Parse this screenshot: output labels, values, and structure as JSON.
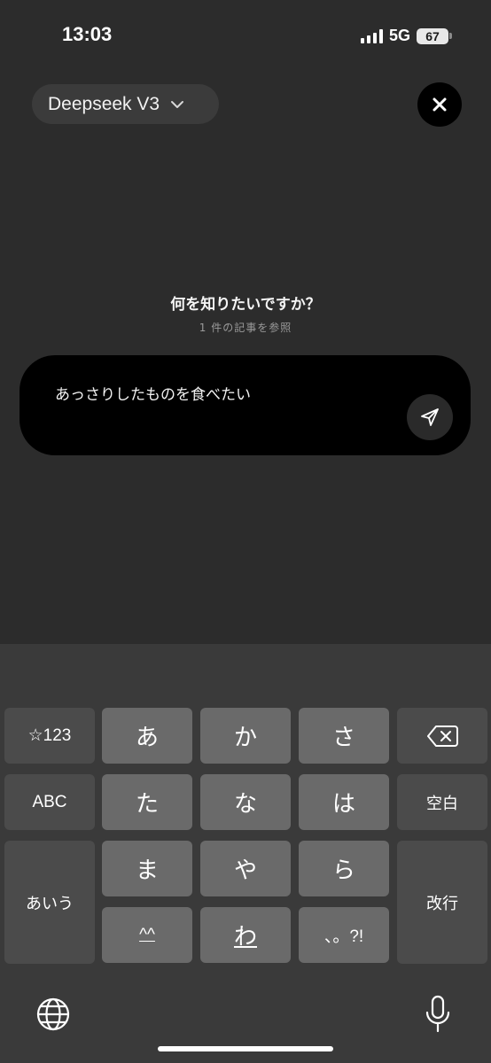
{
  "status_bar": {
    "time": "13:03",
    "network": "5G",
    "battery": "67"
  },
  "header": {
    "model_label": "Deepseek V3"
  },
  "prompt": {
    "title": "何を知りたいですか？",
    "subtitle": "1 件の記事を参照",
    "input_value": "あっさりしたものを食べたい"
  },
  "keyboard": {
    "row1": {
      "mode": "☆123",
      "k1": "あ",
      "k2": "か",
      "k3": "さ"
    },
    "row2": {
      "mode": "ABC",
      "k1": "た",
      "k2": "な",
      "k3": "は",
      "space": "空白"
    },
    "row3": {
      "mode": "あいう",
      "k1": "ま",
      "k2": "や",
      "k3": "ら",
      "enter": "改行"
    },
    "row4": {
      "k1": "^^",
      "k2": "わ",
      "k3": "、。?!"
    }
  },
  "icons": {
    "chevron": "chevron-down-icon",
    "close": "close-icon",
    "send": "send-icon",
    "backspace": "backspace-icon",
    "globe": "globe-icon",
    "mic": "microphone-icon"
  }
}
